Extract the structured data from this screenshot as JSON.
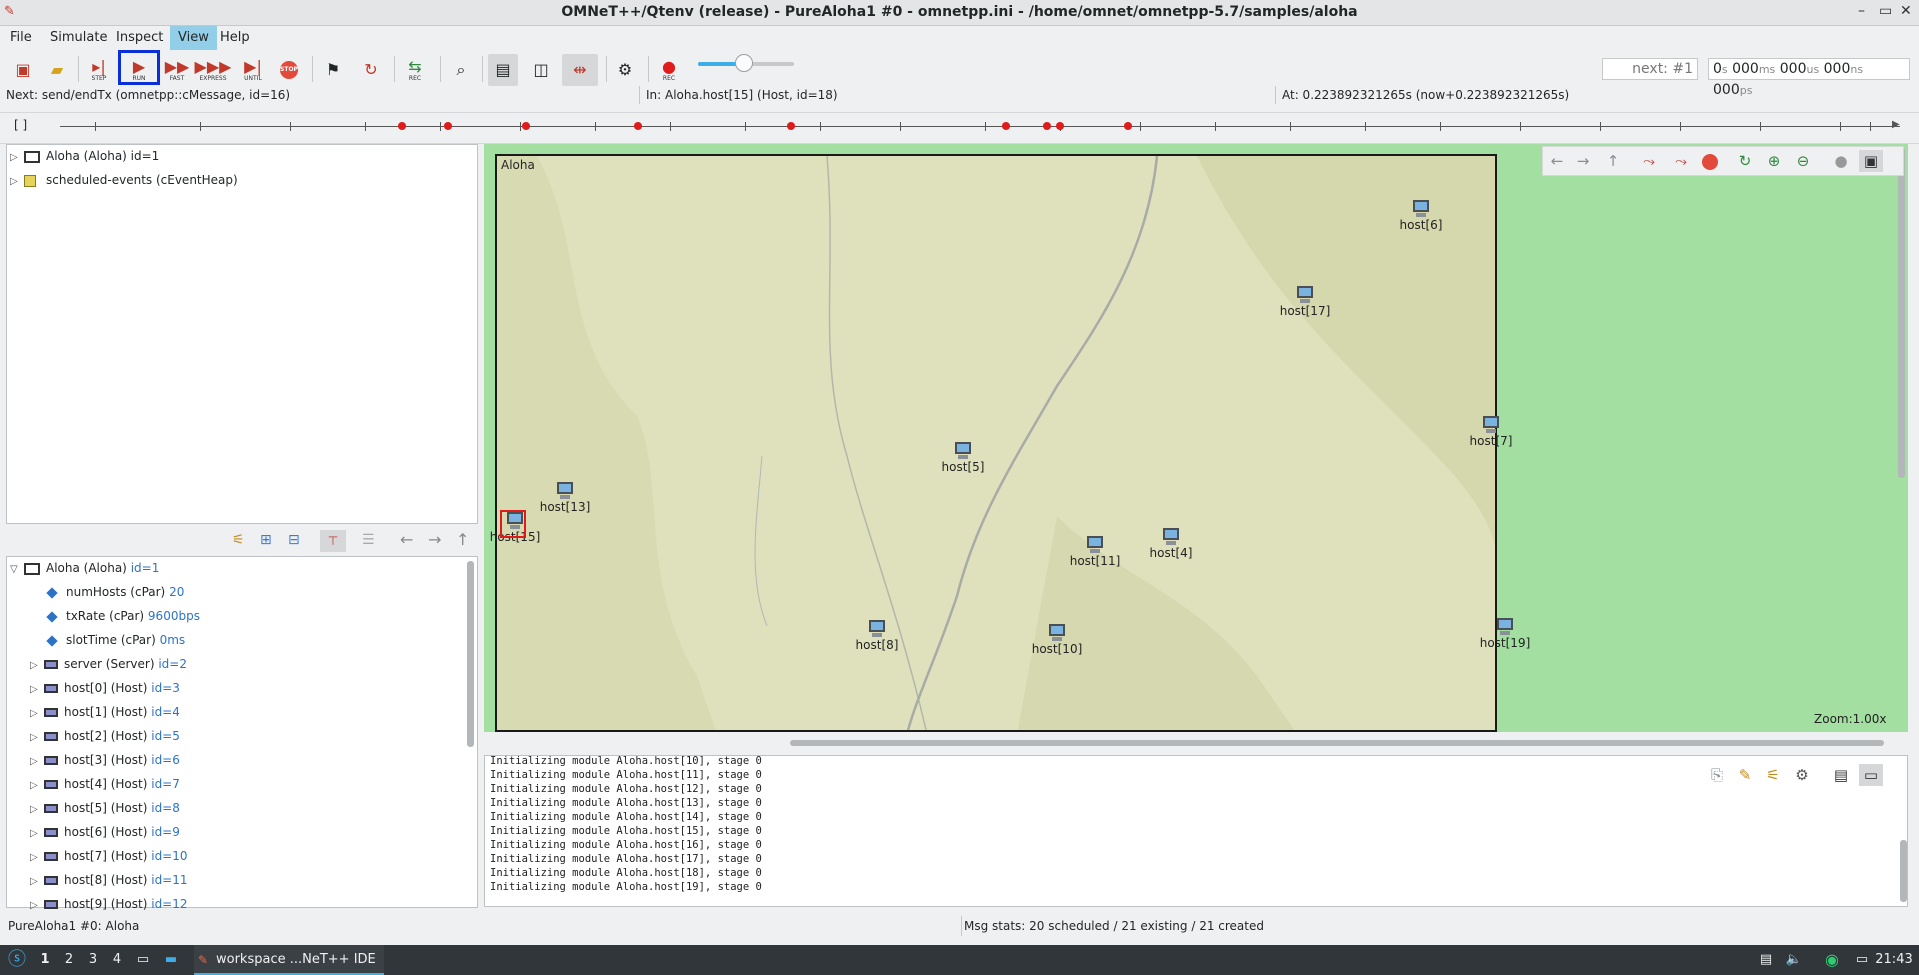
{
  "window": {
    "title": "OMNeT++/Qtenv (release) - PureAloha1 #0 - omnetpp.ini - /home/omnet/omnetpp-5.7/samples/aloha",
    "controls": [
      "–",
      "▭",
      "✕"
    ]
  },
  "menu": [
    "File",
    "Simulate",
    "Inspect",
    "View",
    "Help"
  ],
  "toolbar": {
    "step": "STEP",
    "run": "RUN",
    "fast": "FAST",
    "express": "EXPRESS",
    "until": "UNTIL",
    "stop": "STOP",
    "rec": "REC",
    "rec2": "REC",
    "next_event": "next: #1",
    "sim_time": {
      "s": "0",
      "s_u": "s",
      "ms": "000",
      "ms_u": "ms",
      "us": "000",
      "us_u": "us",
      "ns": "000",
      "ns_u": "ns",
      "ps": "000",
      "ps_u": "ps"
    }
  },
  "status": {
    "next": "Next: send/endTx (omnetpp::cMessage, id=16)",
    "in": "In: Aloha.host[15] (Host, id=18)",
    "at": "At: 0.223892321265s (now+0.223892321265s)"
  },
  "timeline": {
    "brackets": "[ ]",
    "event_markers": 11
  },
  "object_tree": [
    {
      "label": "Aloha (Aloha) id=1"
    },
    {
      "label": "scheduled-events (cEventHeap)"
    }
  ],
  "inspector": {
    "root": {
      "label": "Aloha (Aloha)",
      "id": "id=1"
    },
    "params": [
      {
        "label": "numHosts (cPar)",
        "value": "20"
      },
      {
        "label": "txRate (cPar)",
        "value": "9600bps"
      },
      {
        "label": "slotTime (cPar)",
        "value": "0ms"
      }
    ],
    "submodules": [
      {
        "label": "server (Server)",
        "id": "id=2"
      },
      {
        "label": "host[0] (Host)",
        "id": "id=3"
      },
      {
        "label": "host[1] (Host)",
        "id": "id=4"
      },
      {
        "label": "host[2] (Host)",
        "id": "id=5"
      },
      {
        "label": "host[3] (Host)",
        "id": "id=6"
      },
      {
        "label": "host[4] (Host)",
        "id": "id=7"
      },
      {
        "label": "host[5] (Host)",
        "id": "id=8"
      },
      {
        "label": "host[6] (Host)",
        "id": "id=9"
      },
      {
        "label": "host[7] (Host)",
        "id": "id=10"
      },
      {
        "label": "host[8] (Host)",
        "id": "id=11"
      },
      {
        "label": "host[9] (Host)",
        "id": "id=12"
      }
    ]
  },
  "network": {
    "name": "Aloha",
    "zoom": "Zoom:1.00x",
    "hosts": [
      "host[6]",
      "host[17]",
      "host[7]",
      "host[5]",
      "host[13]",
      "host[15]",
      "host[11]",
      "host[4]",
      "host[8]",
      "host[10]",
      "host[19]"
    ],
    "selected_host": "host[15]"
  },
  "log": [
    "Initializing module Aloha.host[10], stage 0",
    "Initializing module Aloha.host[11], stage 0",
    "Initializing module Aloha.host[12], stage 0",
    "Initializing module Aloha.host[13], stage 0",
    "Initializing module Aloha.host[14], stage 0",
    "Initializing module Aloha.host[15], stage 0",
    "Initializing module Aloha.host[16], stage 0",
    "Initializing module Aloha.host[17], stage 0",
    "Initializing module Aloha.host[18], stage 0",
    "Initializing module Aloha.host[19], stage 0"
  ],
  "bottom_status": {
    "left": "PureAloha1 #0: Aloha",
    "msg_stats": "Msg stats: 20 scheduled / 21 existing / 21 created"
  },
  "taskbar": {
    "workspaces": [
      "1",
      "2",
      "3",
      "4"
    ],
    "task": "workspace ...NeT++ IDE",
    "clock": "21:43"
  },
  "colors": {
    "accent": "#93cee9",
    "run_highlight": "#0a2fd8",
    "id_text": "#2c73c8",
    "canvas_bg": "#a2dfa1",
    "event_marker": "#e01b1b"
  }
}
